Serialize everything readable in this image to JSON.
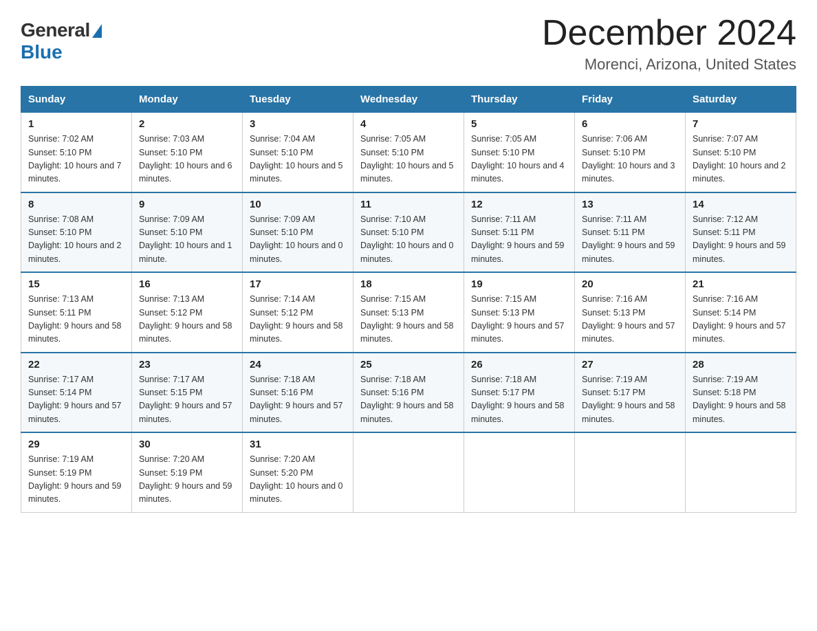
{
  "header": {
    "logo_general": "General",
    "logo_blue": "Blue",
    "month_title": "December 2024",
    "location": "Morenci, Arizona, United States"
  },
  "days_of_week": [
    "Sunday",
    "Monday",
    "Tuesday",
    "Wednesday",
    "Thursday",
    "Friday",
    "Saturday"
  ],
  "weeks": [
    [
      {
        "day": "1",
        "sunrise": "7:02 AM",
        "sunset": "5:10 PM",
        "daylight": "10 hours and 7 minutes."
      },
      {
        "day": "2",
        "sunrise": "7:03 AM",
        "sunset": "5:10 PM",
        "daylight": "10 hours and 6 minutes."
      },
      {
        "day": "3",
        "sunrise": "7:04 AM",
        "sunset": "5:10 PM",
        "daylight": "10 hours and 5 minutes."
      },
      {
        "day": "4",
        "sunrise": "7:05 AM",
        "sunset": "5:10 PM",
        "daylight": "10 hours and 5 minutes."
      },
      {
        "day": "5",
        "sunrise": "7:05 AM",
        "sunset": "5:10 PM",
        "daylight": "10 hours and 4 minutes."
      },
      {
        "day": "6",
        "sunrise": "7:06 AM",
        "sunset": "5:10 PM",
        "daylight": "10 hours and 3 minutes."
      },
      {
        "day": "7",
        "sunrise": "7:07 AM",
        "sunset": "5:10 PM",
        "daylight": "10 hours and 2 minutes."
      }
    ],
    [
      {
        "day": "8",
        "sunrise": "7:08 AM",
        "sunset": "5:10 PM",
        "daylight": "10 hours and 2 minutes."
      },
      {
        "day": "9",
        "sunrise": "7:09 AM",
        "sunset": "5:10 PM",
        "daylight": "10 hours and 1 minute."
      },
      {
        "day": "10",
        "sunrise": "7:09 AM",
        "sunset": "5:10 PM",
        "daylight": "10 hours and 0 minutes."
      },
      {
        "day": "11",
        "sunrise": "7:10 AM",
        "sunset": "5:10 PM",
        "daylight": "10 hours and 0 minutes."
      },
      {
        "day": "12",
        "sunrise": "7:11 AM",
        "sunset": "5:11 PM",
        "daylight": "9 hours and 59 minutes."
      },
      {
        "day": "13",
        "sunrise": "7:11 AM",
        "sunset": "5:11 PM",
        "daylight": "9 hours and 59 minutes."
      },
      {
        "day": "14",
        "sunrise": "7:12 AM",
        "sunset": "5:11 PM",
        "daylight": "9 hours and 59 minutes."
      }
    ],
    [
      {
        "day": "15",
        "sunrise": "7:13 AM",
        "sunset": "5:11 PM",
        "daylight": "9 hours and 58 minutes."
      },
      {
        "day": "16",
        "sunrise": "7:13 AM",
        "sunset": "5:12 PM",
        "daylight": "9 hours and 58 minutes."
      },
      {
        "day": "17",
        "sunrise": "7:14 AM",
        "sunset": "5:12 PM",
        "daylight": "9 hours and 58 minutes."
      },
      {
        "day": "18",
        "sunrise": "7:15 AM",
        "sunset": "5:13 PM",
        "daylight": "9 hours and 58 minutes."
      },
      {
        "day": "19",
        "sunrise": "7:15 AM",
        "sunset": "5:13 PM",
        "daylight": "9 hours and 57 minutes."
      },
      {
        "day": "20",
        "sunrise": "7:16 AM",
        "sunset": "5:13 PM",
        "daylight": "9 hours and 57 minutes."
      },
      {
        "day": "21",
        "sunrise": "7:16 AM",
        "sunset": "5:14 PM",
        "daylight": "9 hours and 57 minutes."
      }
    ],
    [
      {
        "day": "22",
        "sunrise": "7:17 AM",
        "sunset": "5:14 PM",
        "daylight": "9 hours and 57 minutes."
      },
      {
        "day": "23",
        "sunrise": "7:17 AM",
        "sunset": "5:15 PM",
        "daylight": "9 hours and 57 minutes."
      },
      {
        "day": "24",
        "sunrise": "7:18 AM",
        "sunset": "5:16 PM",
        "daylight": "9 hours and 57 minutes."
      },
      {
        "day": "25",
        "sunrise": "7:18 AM",
        "sunset": "5:16 PM",
        "daylight": "9 hours and 58 minutes."
      },
      {
        "day": "26",
        "sunrise": "7:18 AM",
        "sunset": "5:17 PM",
        "daylight": "9 hours and 58 minutes."
      },
      {
        "day": "27",
        "sunrise": "7:19 AM",
        "sunset": "5:17 PM",
        "daylight": "9 hours and 58 minutes."
      },
      {
        "day": "28",
        "sunrise": "7:19 AM",
        "sunset": "5:18 PM",
        "daylight": "9 hours and 58 minutes."
      }
    ],
    [
      {
        "day": "29",
        "sunrise": "7:19 AM",
        "sunset": "5:19 PM",
        "daylight": "9 hours and 59 minutes."
      },
      {
        "day": "30",
        "sunrise": "7:20 AM",
        "sunset": "5:19 PM",
        "daylight": "9 hours and 59 minutes."
      },
      {
        "day": "31",
        "sunrise": "7:20 AM",
        "sunset": "5:20 PM",
        "daylight": "10 hours and 0 minutes."
      },
      null,
      null,
      null,
      null
    ]
  ]
}
